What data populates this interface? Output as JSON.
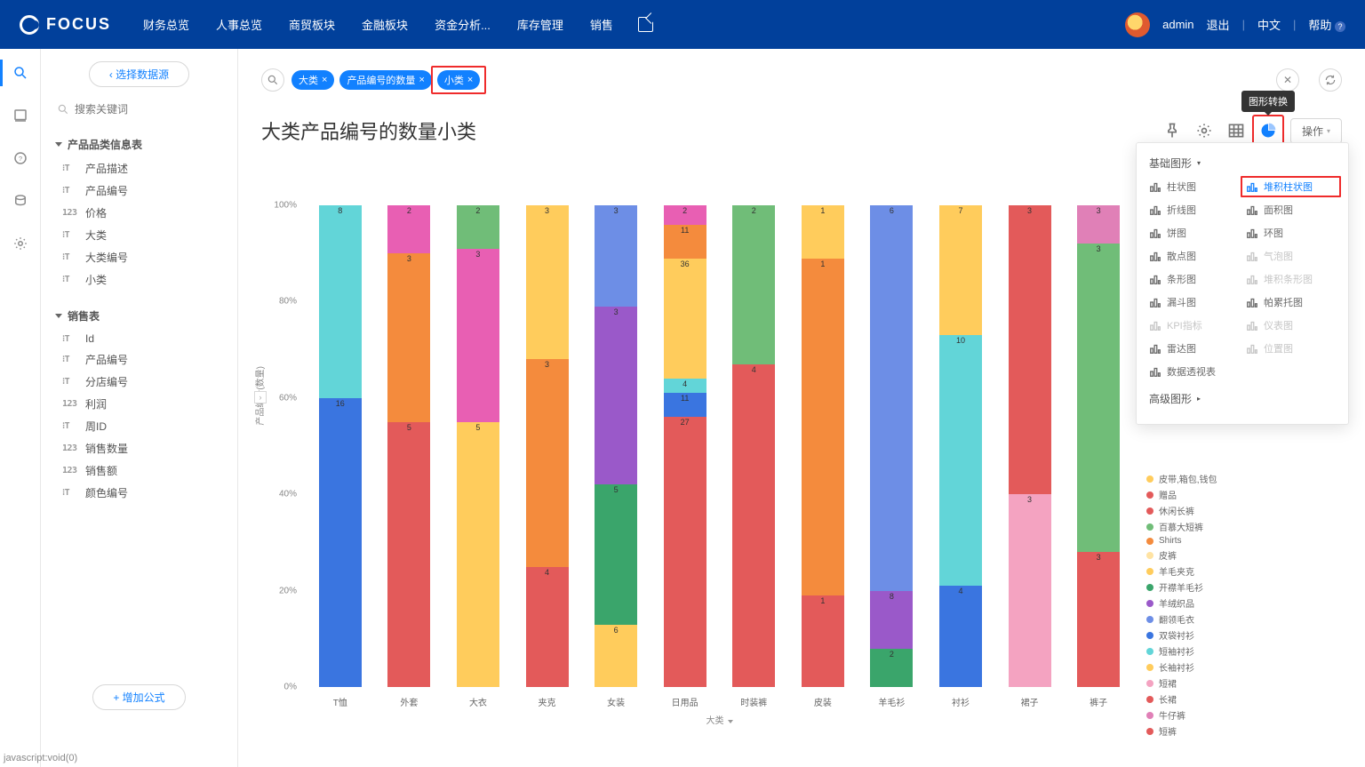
{
  "brand": "FOCUS",
  "nav": [
    "财务总览",
    "人事总览",
    "商贸板块",
    "金融板块",
    "资金分析...",
    "库存管理",
    "销售"
  ],
  "user": {
    "name": "admin",
    "logout": "退出",
    "lang": "中文",
    "help": "帮助"
  },
  "sidebar": {
    "select_data": "‹ 选择数据源",
    "search_ph": "搜索关键词",
    "group1": {
      "title": "产品品类信息表",
      "fields": [
        {
          "icon": "T",
          "label": "产品描述"
        },
        {
          "icon": "T",
          "label": "产品编号"
        },
        {
          "icon": "123",
          "label": "价格"
        },
        {
          "icon": "T",
          "label": "大类"
        },
        {
          "icon": "T",
          "label": "大类编号"
        },
        {
          "icon": "T",
          "label": "小类"
        }
      ]
    },
    "group2": {
      "title": "销售表",
      "fields": [
        {
          "icon": "T",
          "label": "Id"
        },
        {
          "icon": "T",
          "label": "产品编号"
        },
        {
          "icon": "T",
          "label": "分店编号"
        },
        {
          "icon": "123",
          "label": "利润"
        },
        {
          "icon": "T",
          "label": "周ID"
        },
        {
          "icon": "123",
          "label": "销售数量"
        },
        {
          "icon": "123",
          "label": "销售额"
        },
        {
          "icon": "T",
          "label": "颜色编号"
        }
      ]
    },
    "add_formula": "+ 增加公式"
  },
  "query": {
    "chips": [
      {
        "text": "大类",
        "hl": false
      },
      {
        "text": "产品编号的数量",
        "hl": false
      },
      {
        "text": "小类",
        "hl": true
      }
    ]
  },
  "title": "大类产品编号的数量小类",
  "tooltip_chart_switch": "图形转换",
  "operate_btn": "操作",
  "chart_popover": {
    "basic_title": "基础图形",
    "adv_title": "高级图形",
    "types": [
      {
        "label": "柱状图",
        "sel": false,
        "disabled": false
      },
      {
        "label": "堆积柱状图",
        "sel": true,
        "disabled": false
      },
      {
        "label": "折线图",
        "sel": false,
        "disabled": false
      },
      {
        "label": "面积图",
        "sel": false,
        "disabled": false
      },
      {
        "label": "饼图",
        "sel": false,
        "disabled": false
      },
      {
        "label": "环图",
        "sel": false,
        "disabled": false
      },
      {
        "label": "散点图",
        "sel": false,
        "disabled": false
      },
      {
        "label": "气泡图",
        "sel": false,
        "disabled": true
      },
      {
        "label": "条形图",
        "sel": false,
        "disabled": false
      },
      {
        "label": "堆积条形图",
        "sel": false,
        "disabled": true
      },
      {
        "label": "漏斗图",
        "sel": false,
        "disabled": false
      },
      {
        "label": "帕累托图",
        "sel": false,
        "disabled": false
      },
      {
        "label": "KPI指标",
        "sel": false,
        "disabled": true
      },
      {
        "label": "仪表图",
        "sel": false,
        "disabled": true
      },
      {
        "label": "雷达图",
        "sel": false,
        "disabled": false
      },
      {
        "label": "位置图",
        "sel": false,
        "disabled": true
      },
      {
        "label": "数据透视表",
        "sel": false,
        "disabled": false
      }
    ]
  },
  "status_text": "javascript:void(0)",
  "chart_data": {
    "type": "bar",
    "stacked_percent": true,
    "title": "大类产品编号的数量小类",
    "xlabel": "大类",
    "ylabel": "产品编号(数量)",
    "ylim": [
      0,
      100
    ],
    "yticks": [
      0,
      20,
      40,
      60,
      80,
      100
    ],
    "categories": [
      "T恤",
      "外套",
      "大衣",
      "夹克",
      "女装",
      "日用品",
      "时装裤",
      "皮装",
      "羊毛衫",
      "衬衫",
      "裙子",
      "裤子"
    ],
    "legend": [
      {
        "name": "皮带,箱包,钱包",
        "color": "#ffcc5c"
      },
      {
        "name": "赠品",
        "color": "#e35a5a"
      },
      {
        "name": "休闲长裤",
        "color": "#e35a5a"
      },
      {
        "name": "百慕大短裤",
        "color": "#70bd78"
      },
      {
        "name": "Shirts",
        "color": "#f48b3d"
      },
      {
        "name": "皮裤",
        "color": "#ffe3a3"
      },
      {
        "name": "羊毛夹克",
        "color": "#ffcc5c"
      },
      {
        "name": "开襟羊毛衫",
        "color": "#3aa56b"
      },
      {
        "name": "羊绒织品",
        "color": "#9a59c9"
      },
      {
        "name": "翻领毛衣",
        "color": "#6d8ee6"
      },
      {
        "name": "双袋衬衫",
        "color": "#3a75e0"
      },
      {
        "name": "短袖衬衫",
        "color": "#62d5d8"
      },
      {
        "name": "长袖衬衫",
        "color": "#ffcc5c"
      },
      {
        "name": "短裙",
        "color": "#f4a3c1"
      },
      {
        "name": "长裙",
        "color": "#e35a5a"
      },
      {
        "name": "牛仔裤",
        "color": "#e080b7"
      },
      {
        "name": "短裤",
        "color": "#e35a5a"
      }
    ],
    "bars": [
      [
        {
          "h": 60,
          "v": 16,
          "c": "#3a75e0"
        },
        {
          "h": 40,
          "v": 8,
          "c": "#62d5d8"
        }
      ],
      [
        {
          "h": 55,
          "v": 5,
          "c": "#e35a5a"
        },
        {
          "h": 35,
          "v": 3,
          "c": "#f48b3d"
        },
        {
          "h": 10,
          "v": 2,
          "c": "#e85fb3"
        }
      ],
      [
        {
          "h": 55,
          "v": 5,
          "c": "#ffcc5c"
        },
        {
          "h": 36,
          "v": 3,
          "c": "#e85fb3"
        },
        {
          "h": 9,
          "v": 2,
          "c": "#70bd78"
        }
      ],
      [
        {
          "h": 25,
          "v": 4,
          "c": "#e35a5a"
        },
        {
          "h": 43,
          "v": 3,
          "c": "#f48b3d"
        },
        {
          "h": 32,
          "v": 3,
          "c": "#ffcc5c"
        }
      ],
      [
        {
          "h": 13,
          "v": 6,
          "c": "#ffcc5c"
        },
        {
          "h": 29,
          "v": 5,
          "c": "#3aa56b"
        },
        {
          "h": 37,
          "v": 3,
          "c": "#9a59c9"
        },
        {
          "h": 21,
          "v": 3,
          "c": "#6d8ee6"
        }
      ],
      [
        {
          "h": 56,
          "v": 27,
          "c": "#e35a5a"
        },
        {
          "h": 5,
          "v": 11,
          "c": "#3a75e0"
        },
        {
          "h": 3,
          "v": 4,
          "c": "#62d5d8"
        },
        {
          "h": 25,
          "v": 36,
          "c": "#ffcc5c"
        },
        {
          "h": 7,
          "v": 11,
          "c": "#f48b3d"
        },
        {
          "h": 4,
          "v": 2,
          "c": "#e85fb3"
        }
      ],
      [
        {
          "h": 67,
          "v": 4,
          "c": "#e35a5a"
        },
        {
          "h": 33,
          "v": 2,
          "c": "#70bd78"
        }
      ],
      [
        {
          "h": 19,
          "v": 1,
          "c": "#e35a5a"
        },
        {
          "h": 70,
          "v": 1,
          "c": "#f48b3d"
        },
        {
          "h": 11,
          "v": 1,
          "c": "#ffcc5c"
        }
      ],
      [
        {
          "h": 8,
          "v": 2,
          "c": "#3aa56b"
        },
        {
          "h": 12,
          "v": 8,
          "c": "#9a59c9"
        },
        {
          "h": 80,
          "v": 6,
          "c": "#6d8ee6"
        }
      ],
      [
        {
          "h": 21,
          "v": 4,
          "c": "#3a75e0"
        },
        {
          "h": 52,
          "v": 10,
          "c": "#62d5d8"
        },
        {
          "h": 27,
          "v": 7,
          "c": "#ffcc5c"
        }
      ],
      [
        {
          "h": 40,
          "v": 3,
          "c": "#f4a3c1"
        },
        {
          "h": 60,
          "v": 3,
          "c": "#e35a5a"
        }
      ],
      [
        {
          "h": 28,
          "v": 3,
          "c": "#e35a5a"
        },
        {
          "h": 64,
          "v": 3,
          "c": "#70bd78"
        },
        {
          "h": 8,
          "v": 3,
          "c": "#e080b7"
        }
      ]
    ]
  }
}
